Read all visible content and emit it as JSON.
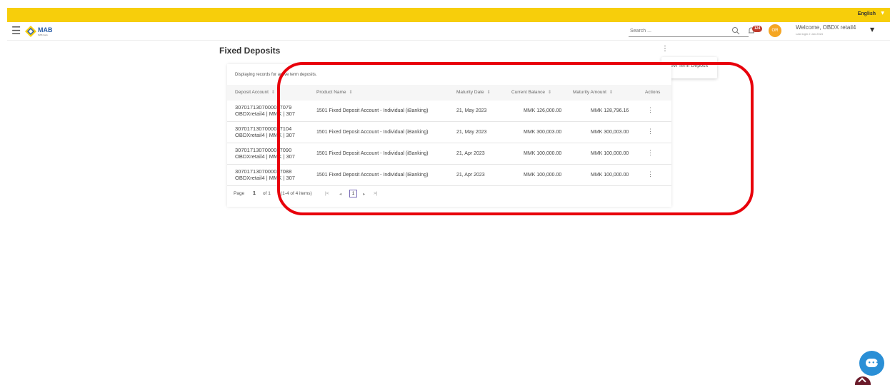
{
  "topbar": {
    "language": "English"
  },
  "header": {
    "brand": "MAB",
    "brand_sub": "MAB bank",
    "search_placeholder": "Search ...",
    "notification_count": "124",
    "avatar_initials": "OR",
    "welcome": "Welcome, OBDX retail4",
    "last_login": "Last login 2 Jan 2024"
  },
  "page": {
    "title": "Fixed Deposits",
    "menu_item": "New Term Deposit",
    "display_info": "Displaying records for active term deposits."
  },
  "table": {
    "headers": {
      "deposit_account": "Deposit Account",
      "product_name": "Product Name",
      "maturity_date": "Maturity Date",
      "current_balance": "Current Balance",
      "maturity_amount": "Maturity Amount",
      "actions": "Actions"
    },
    "rows": [
      {
        "account": "3070171307000037079",
        "account_sub": "OBDXretail4 | MMK | 307",
        "product": "1501 Fixed Deposit Account - Individual (iBanking)",
        "maturity_date": "21, May 2023",
        "current_balance": "MMK 126,000.00",
        "maturity_amount": "MMK 128,796.16"
      },
      {
        "account": "3070171307000037104",
        "account_sub": "OBDXretail4 | MMK | 307",
        "product": "1501 Fixed Deposit Account - Individual (iBanking)",
        "maturity_date": "21, May 2023",
        "current_balance": "MMK 300,003.00",
        "maturity_amount": "MMK 300,003.00"
      },
      {
        "account": "3070171307000037090",
        "account_sub": "OBDXretail4 | MMK | 307",
        "product": "1501 Fixed Deposit Account - Individual (iBanking)",
        "maturity_date": "21, Apr 2023",
        "current_balance": "MMK 100,000.00",
        "maturity_amount": "MMK 100,000.00"
      },
      {
        "account": "3070171307000037088",
        "account_sub": "OBDXretail4 | MMK | 307",
        "product": "1501 Fixed Deposit Account - Individual (iBanking)",
        "maturity_date": "21, Apr 2023",
        "current_balance": "MMK 100,000.00",
        "maturity_amount": "MMK 100,000.00"
      }
    ]
  },
  "pager": {
    "page_label": "Page",
    "page_num": "1",
    "of_label": "of 1",
    "items_label": "(1-4 of 4 items)",
    "current": "1"
  },
  "colors": {
    "topbar": "#f7ce0b",
    "annotation": "#e8000b",
    "chat": "#2a8fd6",
    "scroll_top": "#6a1b2a"
  }
}
